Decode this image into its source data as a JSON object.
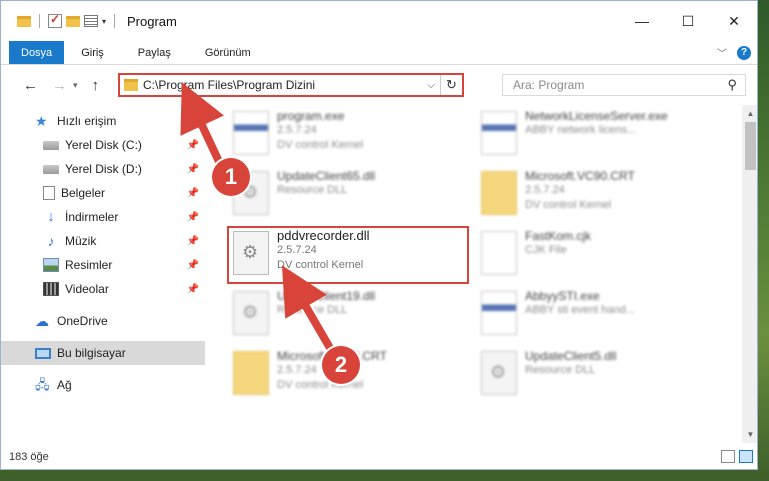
{
  "window": {
    "title": "Program",
    "controls": {
      "minimize": "—",
      "maximize": "☐",
      "close": "✕"
    }
  },
  "ribbon": {
    "tabs": [
      "Dosya",
      "Giriş",
      "Paylaş",
      "Görünüm"
    ],
    "help": "?"
  },
  "address_bar": {
    "path": "C:\\Program Files\\Program Dizini",
    "search_placeholder": "Ara: Program"
  },
  "sidebar": {
    "quick_access": "Hızlı erişim",
    "items": [
      {
        "label": "Yerel Disk (C:)",
        "icon": "disk-icon",
        "pinned": true
      },
      {
        "label": "Yerel Disk (D:)",
        "icon": "disk-icon",
        "pinned": true
      },
      {
        "label": "Belgeler",
        "icon": "documents-icon",
        "pinned": true
      },
      {
        "label": "İndirmeler",
        "icon": "download-icon",
        "pinned": true
      },
      {
        "label": "Müzik",
        "icon": "music-icon",
        "pinned": true
      },
      {
        "label": "Resimler",
        "icon": "pictures-icon",
        "pinned": true
      },
      {
        "label": "Videolar",
        "icon": "videos-icon",
        "pinned": true
      }
    ],
    "onedrive": "OneDrive",
    "this_pc": "Bu bilgisayar",
    "network": "Ağ"
  },
  "files": [
    {
      "name": "program.exe",
      "line2": "2.5.7.24",
      "line3": "DV control Kernel",
      "icon": "exe-icon"
    },
    {
      "name": "NetworkLicenseServer.exe",
      "line2": "ABBY network licens...",
      "line3": "",
      "icon": "exe-icon"
    },
    {
      "name": "UpdateClient65.dll",
      "line2": "Resource DLL",
      "line3": "",
      "icon": "dll-icon"
    },
    {
      "name": "Microsoft.VC90.CRT",
      "line2": "2.5.7.24",
      "line3": "DV control Kernel",
      "icon": "folder-icon"
    },
    {
      "name": "pddvrecorder.dll",
      "line2": "2.5.7.24",
      "line3": "DV control Kernel",
      "icon": "dll-icon"
    },
    {
      "name": "FastKom.cjk",
      "line2": "CJK File",
      "line3": "",
      "icon": "file-icon"
    },
    {
      "name": "UpdateClient19.dll",
      "line2": "Resource DLL",
      "line3": "",
      "icon": "dll-icon"
    },
    {
      "name": "AbbyySTI.exe",
      "line2": "ABBY sti event hand...",
      "line3": "",
      "icon": "exe-icon"
    },
    {
      "name": "Microsoft.VC90.CRT",
      "line2": "2.5.7.24",
      "line3": "DV control Kernel",
      "icon": "folder-icon"
    },
    {
      "name": "UpdateClient5.dll",
      "line2": "Resource DLL",
      "line3": "",
      "icon": "dll-icon"
    }
  ],
  "status": {
    "item_count": "183 öğe"
  },
  "annotations": {
    "marker1": "1",
    "marker2": "2"
  },
  "colors": {
    "accent": "#1979ca",
    "highlight": "#d9443a"
  }
}
